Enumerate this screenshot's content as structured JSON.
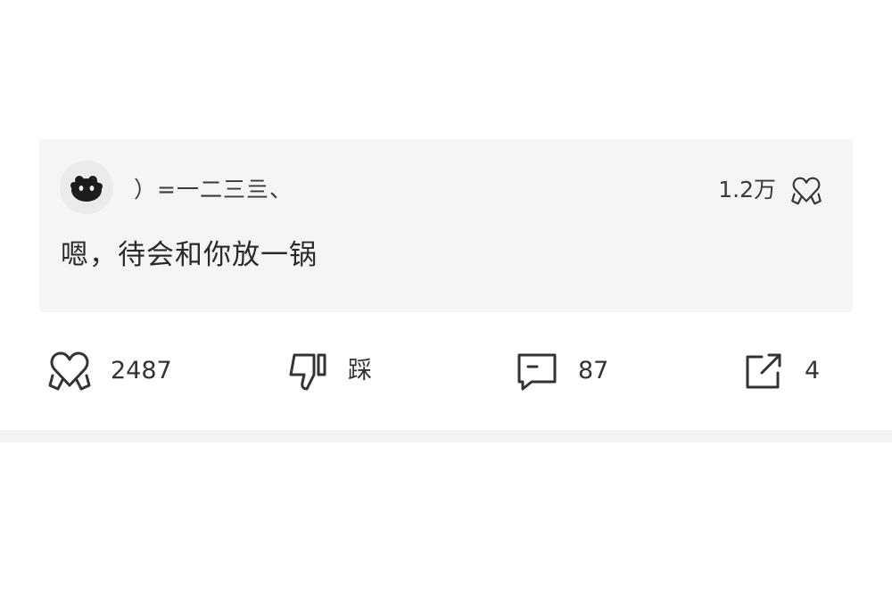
{
  "comment": {
    "username": "）=一二三亖、",
    "like_count": "1.2万",
    "text": "嗯，待会和你放一锅"
  },
  "actions": {
    "like_count": "2487",
    "dislike_label": "踩",
    "comment_count": "87",
    "share_count": "4"
  },
  "icons": {
    "avatar": "black-furball-avatar",
    "like_small": "heart-hands-icon",
    "like": "heart-hands-icon",
    "dislike": "thumbs-down-icon",
    "comment": "speech-bubble-icon",
    "share": "share-arrow-icon"
  }
}
